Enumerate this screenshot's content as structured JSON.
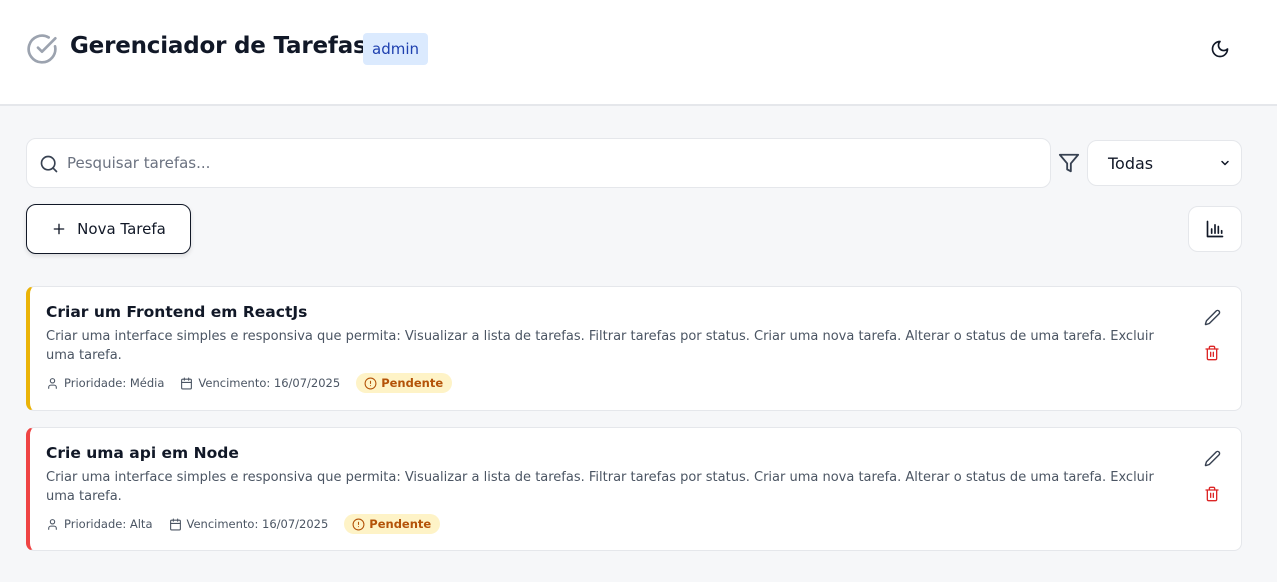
{
  "header": {
    "title": "Gerenciador de Tarefas",
    "role_badge": "admin",
    "logo_icon": "check-circle-icon",
    "theme_icon": "moon-icon"
  },
  "toolbar": {
    "search_placeholder": "Pesquisar tarefas...",
    "search_value": "",
    "filter_icon": "filter-icon",
    "status_filter": "Todas",
    "new_task_label": "Nova Tarefa",
    "stats_icon": "bar-chart-icon"
  },
  "colors": {
    "accent_medium": "#eab308",
    "accent_high": "#ef4444",
    "badge_bg": "#dbeafe",
    "badge_text": "#1e40af",
    "pending_bg": "#fef3c7",
    "pending_text": "#b45309",
    "delete_red": "#dc2626"
  },
  "tasks": [
    {
      "title": "Criar um Frontend em ReactJs",
      "description": "Criar uma interface simples e responsiva que permita: Visualizar a lista de tarefas. Filtrar tarefas por status. Criar uma nova tarefa. Alterar o status de uma tarefa. Excluir uma tarefa.",
      "priority": "Prioridade: Média",
      "due": "Vencimento: 16/07/2025",
      "status": "Pendente"
    },
    {
      "title": "Crie uma api em Node",
      "description": "Criar uma interface simples e responsiva que permita: Visualizar a lista de tarefas. Filtrar tarefas por status. Criar uma nova tarefa. Alterar o status de uma tarefa. Excluir uma tarefa.",
      "priority": "Prioridade: Alta",
      "due": "Vencimento: 16/07/2025",
      "status": "Pendente"
    }
  ]
}
